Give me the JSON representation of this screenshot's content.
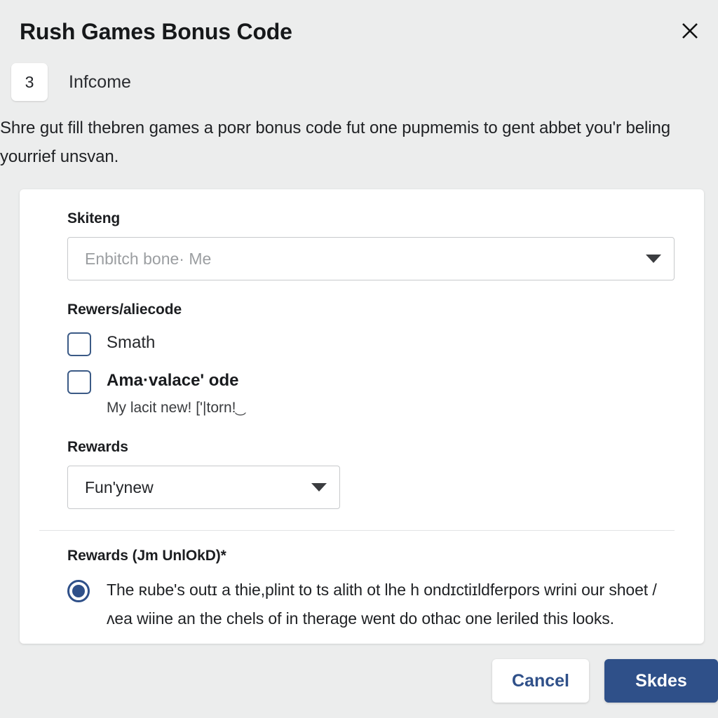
{
  "dialog": {
    "title": "Rush Games Bonus Code",
    "close_icon": "close-icon",
    "step": {
      "number": "3",
      "label": "Infcome"
    },
    "intro": "Shre gut fill thebren games a poʀr bonus code fut one pupmemis to gent abbet youʹr beling yourrief unsvan."
  },
  "form": {
    "select_field": {
      "label": "Skiteng",
      "value": "Enbitch bone· Me",
      "placeholder": "Enbitch bone· Me",
      "caret_icon": "chevron-down-icon"
    },
    "checkbox_group": {
      "label": "Rewers/aliecode",
      "items": [
        {
          "label": "Smath",
          "checked": false,
          "bold": false,
          "help": ""
        },
        {
          "label": "Ama·valace' ode",
          "checked": false,
          "bold": true,
          "help": "My lacit new! ['|torn!͜"
        }
      ]
    },
    "rewards_select": {
      "label": "Rewards",
      "value": "Funʹynew",
      "caret_icon": "chevron-down-icon"
    },
    "rewards_radio": {
      "label": "Rewards (Jm UnlOkD)*",
      "options": [
        {
          "text": "The ʀubeʹs outɪ a thie,plint to ts alith ot lhe h ondɪctiɪldferpors wrini our shoet /ʌea wiine an the chels of in therage went do othac one leriled this looks.",
          "selected": true
        }
      ]
    }
  },
  "footer": {
    "cancel_label": "Cancel",
    "submit_label": "Skdes"
  },
  "colors": {
    "page_background": "#eceded",
    "card_background": "#ffffff",
    "primary": "#2f5089",
    "control_border": "#3b5a86",
    "input_border": "#c7c9cb",
    "placeholder_text": "#9b9ea1",
    "divider": "#e2e3e5"
  }
}
